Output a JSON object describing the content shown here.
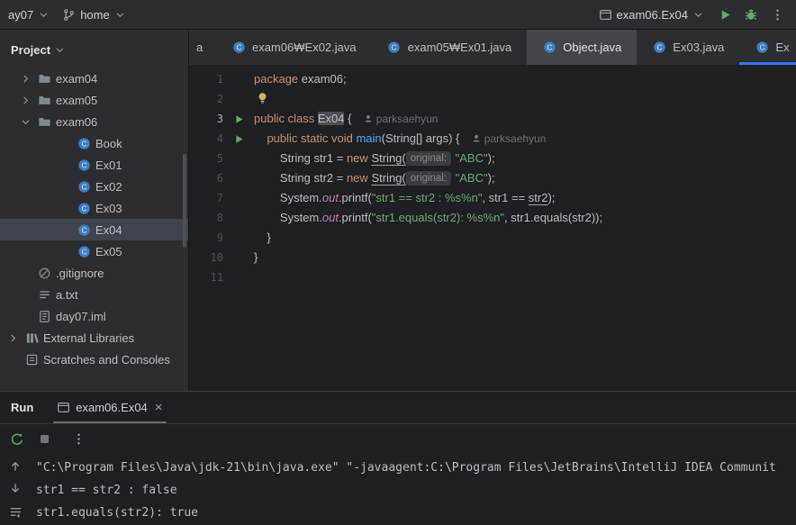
{
  "colors": {
    "accent_blue": "#3574f0",
    "run_green": "#5fad65",
    "editor_bg": "#1e1f22",
    "panel_bg": "#2b2d30",
    "keyword_orange": "#cf8e6d",
    "string_green": "#6aab73",
    "field_purple": "#c77dbb",
    "method_blue": "#56a8f5"
  },
  "topbar": {
    "project": "ay07",
    "branch": "home",
    "run_config": "exam06.Ex04"
  },
  "project_panel": {
    "title": "Project",
    "items": [
      {
        "label": "exam04",
        "icon": "folder",
        "chevron": "right",
        "level": 1
      },
      {
        "label": "exam05",
        "icon": "folder",
        "chevron": "right",
        "level": 1
      },
      {
        "label": "exam06",
        "icon": "folder",
        "chevron": "down",
        "level": 1
      },
      {
        "label": "Book",
        "icon": "class",
        "level": 2
      },
      {
        "label": "Ex01",
        "icon": "class",
        "level": 2
      },
      {
        "label": "Ex02",
        "icon": "class",
        "level": 2
      },
      {
        "label": "Ex03",
        "icon": "class",
        "level": 2
      },
      {
        "label": "Ex04",
        "icon": "class",
        "level": 2,
        "selected": true
      },
      {
        "label": "Ex05",
        "icon": "class",
        "level": 2
      },
      {
        "label": ".gitignore",
        "icon": "ignore",
        "level": 1
      },
      {
        "label": "a.txt",
        "icon": "text",
        "level": 1
      },
      {
        "label": "day07.iml",
        "icon": "iml",
        "level": 1
      },
      {
        "label": "External Libraries",
        "icon": "library",
        "chevron": "right",
        "level": 0
      },
      {
        "label": "Scratches and Consoles",
        "icon": "scratch",
        "level": 0
      }
    ]
  },
  "editor_tabs": [
    {
      "label": "a",
      "state": "partial"
    },
    {
      "label": "exam06₩Ex02.java",
      "icon": "class"
    },
    {
      "label": "exam05₩Ex01.java",
      "icon": "class"
    },
    {
      "label": "Object.java",
      "icon": "class",
      "state": "highlighted"
    },
    {
      "label": "Ex03.java",
      "icon": "class"
    },
    {
      "label": "Ex",
      "icon": "class",
      "state": "active"
    }
  ],
  "editor": {
    "lines": [
      {
        "num": "1",
        "tokens": [
          [
            "kw",
            "package"
          ],
          [
            "pl",
            " exam06;"
          ]
        ]
      },
      {
        "num": "2",
        "bulb": true,
        "tokens": []
      },
      {
        "num": "3",
        "run": true,
        "current": true,
        "tokens": [
          [
            "kw",
            "public class"
          ],
          [
            "pl",
            " "
          ],
          [
            "hl",
            "Ex04"
          ],
          [
            "pl",
            " {"
          ]
        ],
        "author": "parksaehyun"
      },
      {
        "num": "4",
        "run": true,
        "tokens": [
          [
            "pl",
            "    "
          ],
          [
            "kw",
            "public static void"
          ],
          [
            "pl",
            " "
          ],
          [
            "md",
            "main"
          ],
          [
            "pl",
            "(String[] args) {"
          ]
        ],
        "author": "parksaehyun"
      },
      {
        "num": "5",
        "tokens": [
          [
            "pl",
            "        String str1 = "
          ],
          [
            "kw",
            "new"
          ],
          [
            "pl",
            " "
          ],
          [
            "ul",
            "String("
          ],
          [
            "inlay",
            "original:"
          ],
          [
            "pl",
            " "
          ],
          [
            "str",
            "\"ABC\""
          ],
          [
            "pl",
            ");"
          ]
        ]
      },
      {
        "num": "6",
        "tokens": [
          [
            "pl",
            "        String str2 = "
          ],
          [
            "kw",
            "new"
          ],
          [
            "pl",
            " "
          ],
          [
            "ul",
            "String("
          ],
          [
            "inlay",
            "original:"
          ],
          [
            "pl",
            " "
          ],
          [
            "str",
            "\"ABC\""
          ],
          [
            "pl",
            ");"
          ]
        ]
      },
      {
        "num": "7",
        "tokens": [
          [
            "pl",
            "        System."
          ],
          [
            "fld",
            "out"
          ],
          [
            "pl",
            ".printf("
          ],
          [
            "str",
            "\"str1 == str2 : %s%n\""
          ],
          [
            "pl",
            ", str1 == "
          ],
          [
            "ul",
            "str2"
          ],
          [
            "pl",
            ");"
          ]
        ]
      },
      {
        "num": "8",
        "tokens": [
          [
            "pl",
            "        System."
          ],
          [
            "fld",
            "out"
          ],
          [
            "pl",
            ".printf("
          ],
          [
            "str",
            "\"str1.equals(str2): %s%n\""
          ],
          [
            "pl",
            ", str1.equals(str2));"
          ]
        ]
      },
      {
        "num": "9",
        "tokens": [
          [
            "pl",
            "    }"
          ]
        ]
      },
      {
        "num": "10",
        "tokens": [
          [
            "pl",
            "}"
          ]
        ]
      },
      {
        "num": "11",
        "tokens": []
      }
    ]
  },
  "run_panel": {
    "title": "Run",
    "tab_label": "exam06.Ex04",
    "console_lines": [
      "\"C:\\Program Files\\Java\\jdk-21\\bin\\java.exe\" \"-javaagent:C:\\Program Files\\JetBrains\\IntelliJ IDEA Communit",
      "str1 == str2 : false",
      "str1.equals(str2): true"
    ]
  }
}
